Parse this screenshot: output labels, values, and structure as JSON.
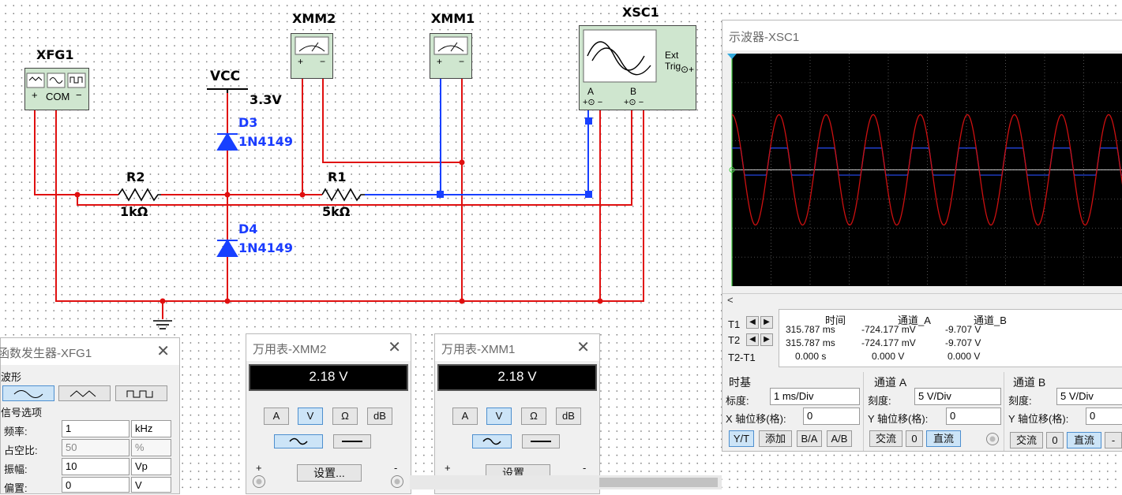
{
  "components": {
    "xfg1": "XFG1",
    "xfg1_com": "COM",
    "xmm2": "XMM2",
    "xmm1": "XMM1",
    "xsc1": "XSC1",
    "xsc1_ext_trig": "Ext Trig",
    "xsc1_a": "A",
    "xsc1_b": "B",
    "vcc": "VCC",
    "vcc_value": "3.3V",
    "d3": "D3",
    "d3_part": "1N4149",
    "d4": "D4",
    "d4_part": "1N4149",
    "r2": "R2",
    "r2_value": "1kΩ",
    "r1": "R1",
    "r1_value": "5kΩ"
  },
  "function_generator": {
    "title": "函数发生器-XFG1",
    "waveform_label": "波形",
    "signal_options_label": "信号选项",
    "rows": [
      {
        "label": "频率:",
        "value": "1",
        "unit": "kHz"
      },
      {
        "label": "占空比:",
        "value": "50",
        "unit": "%"
      },
      {
        "label": "振幅:",
        "value": "10",
        "unit": "Vp"
      },
      {
        "label": "偏置:",
        "value": "0",
        "unit": "V"
      }
    ]
  },
  "multimeter_xmm2": {
    "title": "万用表-XMM2",
    "reading": "2.18 V",
    "modes": [
      "A",
      "V",
      "Ω",
      "dB"
    ],
    "selected_mode": "V",
    "settings": "设置...",
    "plus": "+",
    "minus": "-"
  },
  "multimeter_xmm1": {
    "title": "万用表-XMM1",
    "reading": "2.18 V",
    "modes": [
      "A",
      "V",
      "Ω",
      "dB"
    ],
    "selected_mode": "V",
    "settings": "设置...",
    "plus": "+",
    "minus": "-"
  },
  "oscilloscope": {
    "title": "示波器-XSC1",
    "table_headers": [
      "时间",
      "通道_A",
      "通道_B"
    ],
    "rows": [
      {
        "label": "T1",
        "time": "315.787 ms",
        "a": "-724.177 mV",
        "b": "-9.707 V"
      },
      {
        "label": "T2",
        "time": "315.787 ms",
        "a": "-724.177 mV",
        "b": "-9.707 V"
      },
      {
        "label": "T2-T1",
        "time": "0.000 s",
        "a": "0.000 V",
        "b": "0.000 V"
      }
    ],
    "timebase": {
      "title": "时基",
      "scale_label": "标度:",
      "scale": "1 ms/Div",
      "xpos_label": "X 轴位移(格):",
      "xpos": "0",
      "buttons": [
        "Y/T",
        "添加",
        "B/A",
        "A/B"
      ]
    },
    "channel_a": {
      "title": "通道 A",
      "scale_label": "刻度:",
      "scale": "5  V/Div",
      "ypos_label": "Y 轴位移(格):",
      "ypos": "0",
      "buttons": [
        "交流",
        "0",
        "直流"
      ]
    },
    "channel_b": {
      "title": "通道 B",
      "scale_label": "刻度:",
      "scale": "5  V/Div",
      "ypos_label": "Y 轴位移(格):",
      "ypos": "0",
      "buttons": [
        "交流",
        "0",
        "直流",
        "-"
      ]
    },
    "scroll_left": "<",
    "colors": {
      "channel_a": "#cc1010",
      "channel_b": "#2244dd",
      "screen": "#000000",
      "grid": "#8a8a8a"
    },
    "waveform": {
      "cycles_visible": 8.3,
      "channel_a_peak_div": 1.9,
      "channel_b_high_div": 0.75,
      "channel_b_low_div": -0.18
    }
  }
}
